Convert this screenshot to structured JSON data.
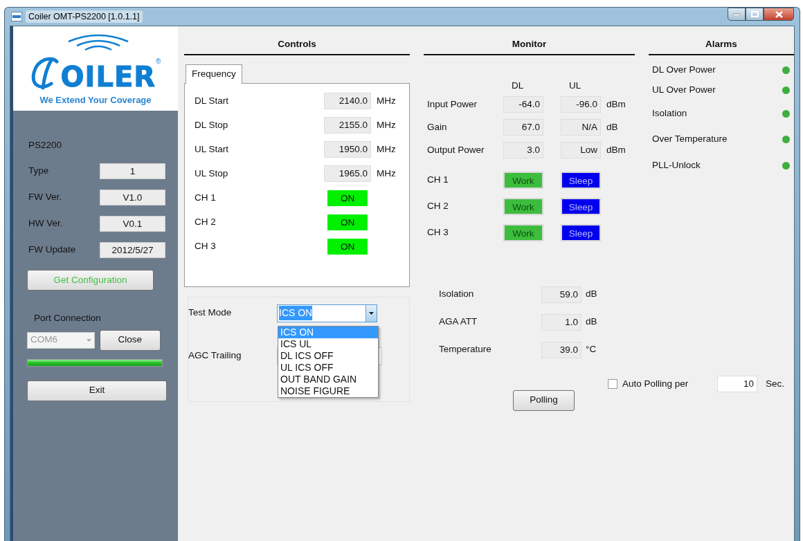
{
  "window": {
    "title": "Coiler OMT-PS2200 [1.0.1.1]"
  },
  "logo": {
    "wordmark": "OILER",
    "registered": "®",
    "tagline": "We Extend Your Coverage"
  },
  "device": {
    "model": "PS2200",
    "fields": [
      {
        "label": "Type",
        "value": "1"
      },
      {
        "label": "FW Ver.",
        "value": "V1.0"
      },
      {
        "label": "HW Ver.",
        "value": "V0.1"
      },
      {
        "label": "FW Update",
        "value": "2012/5/27"
      }
    ],
    "get_config_button": "Get Configuration",
    "port": {
      "label": "Port Connection",
      "value": "COM6",
      "disabled": true,
      "close_button": "Close",
      "level": 1
    },
    "exit_button": "Exit"
  },
  "controls": {
    "title": "Controls",
    "tabs": [
      {
        "label": "Frequency",
        "selected": true
      }
    ],
    "freq": [
      {
        "label": "DL Start",
        "value": "2140.0",
        "unit": "MHz"
      },
      {
        "label": "DL Stop",
        "value": "2155.0",
        "unit": "MHz"
      },
      {
        "label": "UL Start",
        "value": "1950.0",
        "unit": "MHz"
      },
      {
        "label": "UL Stop",
        "value": "1965.0",
        "unit": "MHz"
      }
    ],
    "channels": [
      {
        "label": "CH 1",
        "state": "ON",
        "on": true
      },
      {
        "label": "CH 2",
        "state": "ON",
        "on": true
      },
      {
        "label": "CH 3",
        "state": "ON",
        "on": true
      }
    ],
    "test_mode": {
      "label": "Test Mode",
      "value": "ICS ON",
      "expanded": true,
      "options": [
        {
          "label": "ICS ON",
          "selected": true
        },
        {
          "label": "ICS UL",
          "selected": false
        },
        {
          "label": "DL ICS OFF",
          "selected": false
        },
        {
          "label": "UL ICS OFF",
          "selected": false
        },
        {
          "label": "OUT BAND GAIN",
          "selected": false
        },
        {
          "label": "NOISE FIGURE",
          "selected": false
        }
      ]
    },
    "agc_trailing": {
      "label": "AGC Trailing"
    }
  },
  "monitor": {
    "title": "Monitor",
    "columns": [
      "DL",
      "UL"
    ],
    "rows": [
      {
        "label": "Input Power",
        "dl": "-64.0",
        "ul": "-96.0",
        "unit": "dBm"
      },
      {
        "label": "Gain",
        "dl": "67.0",
        "ul": "N/A",
        "unit": "dB"
      },
      {
        "label": "Output Power",
        "dl": "3.0",
        "ul": "Low",
        "unit": "dBm"
      }
    ],
    "channels": [
      {
        "label": "CH 1",
        "dl": {
          "text": "Work",
          "kind": "work"
        },
        "ul": {
          "text": "Sleep",
          "kind": "sleep"
        }
      },
      {
        "label": "CH 2",
        "dl": {
          "text": "Work",
          "kind": "work"
        },
        "ul": {
          "text": "Sleep",
          "kind": "sleep"
        }
      },
      {
        "label": "CH 3",
        "dl": {
          "text": "Work",
          "kind": "work"
        },
        "ul": {
          "text": "Sleep",
          "kind": "sleep"
        }
      }
    ],
    "readings": [
      {
        "label": "Isolation",
        "value": "59.0",
        "unit": "dB"
      },
      {
        "label": "AGA ATT",
        "value": "1.0",
        "unit": "dB"
      },
      {
        "label": "Temperature",
        "value": "39.0",
        "unit": "°C"
      }
    ],
    "polling_button": "Polling",
    "auto_polling": {
      "label": "Auto Polling per",
      "checked": false,
      "value": "10",
      "unit": "Sec."
    }
  },
  "alarms": {
    "title": "Alarms",
    "items": [
      {
        "label": "DL Over Power",
        "color": "#3fae3f"
      },
      {
        "label": "UL Over Power",
        "color": "#3fae3f"
      },
      {
        "label": "Isolation",
        "color": "#3fae3f"
      },
      {
        "label": "Over Temperature",
        "color": "#3fae3f"
      },
      {
        "label": "PLL-Unlock",
        "color": "#3fae3f"
      }
    ]
  }
}
